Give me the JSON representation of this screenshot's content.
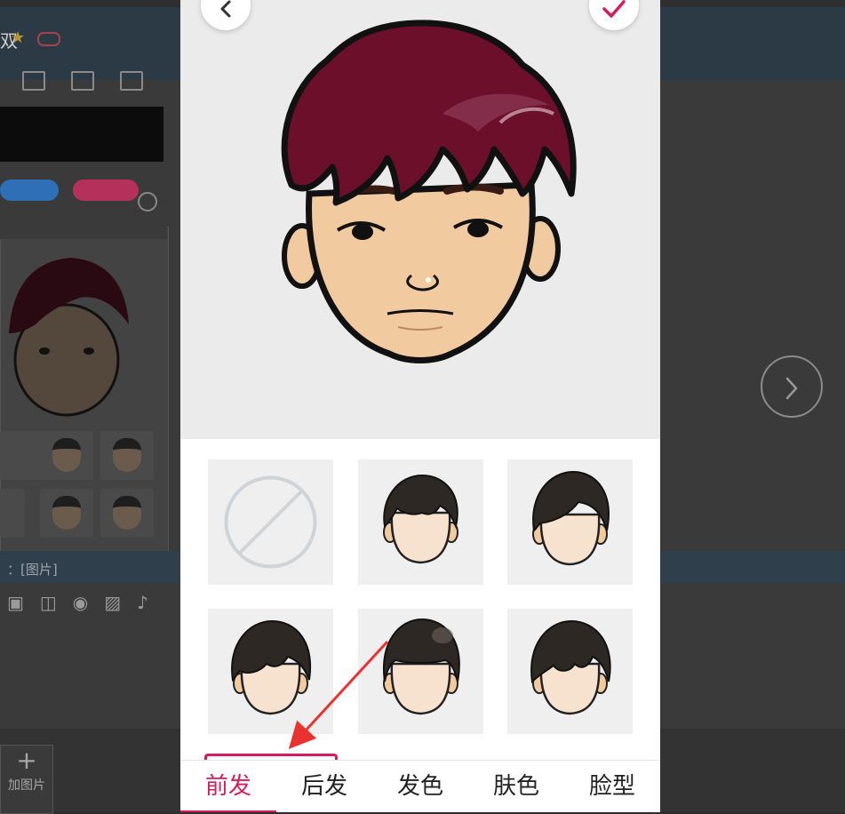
{
  "background_app": {
    "title_fragment": "双",
    "hint_text": "：[图片]",
    "add_image_label": "加图片",
    "add_image_plus": "+"
  },
  "editor": {
    "tabs": [
      {
        "label": "前发",
        "active": true
      },
      {
        "label": "后发",
        "active": false
      },
      {
        "label": "发色",
        "active": false
      },
      {
        "label": "肤色",
        "active": false
      },
      {
        "label": "脸型",
        "active": false
      }
    ],
    "hair_color": "#6b0f2a",
    "skin_color": "#f2caa0",
    "accent_color": "#d81b5c",
    "options": [
      {
        "icon": "no-hair-icon"
      },
      {
        "icon": "hair-style-1-icon"
      },
      {
        "icon": "hair-style-2-icon"
      },
      {
        "icon": "hair-style-3-icon"
      },
      {
        "icon": "hair-style-4-icon"
      },
      {
        "icon": "hair-style-5-icon"
      }
    ]
  }
}
